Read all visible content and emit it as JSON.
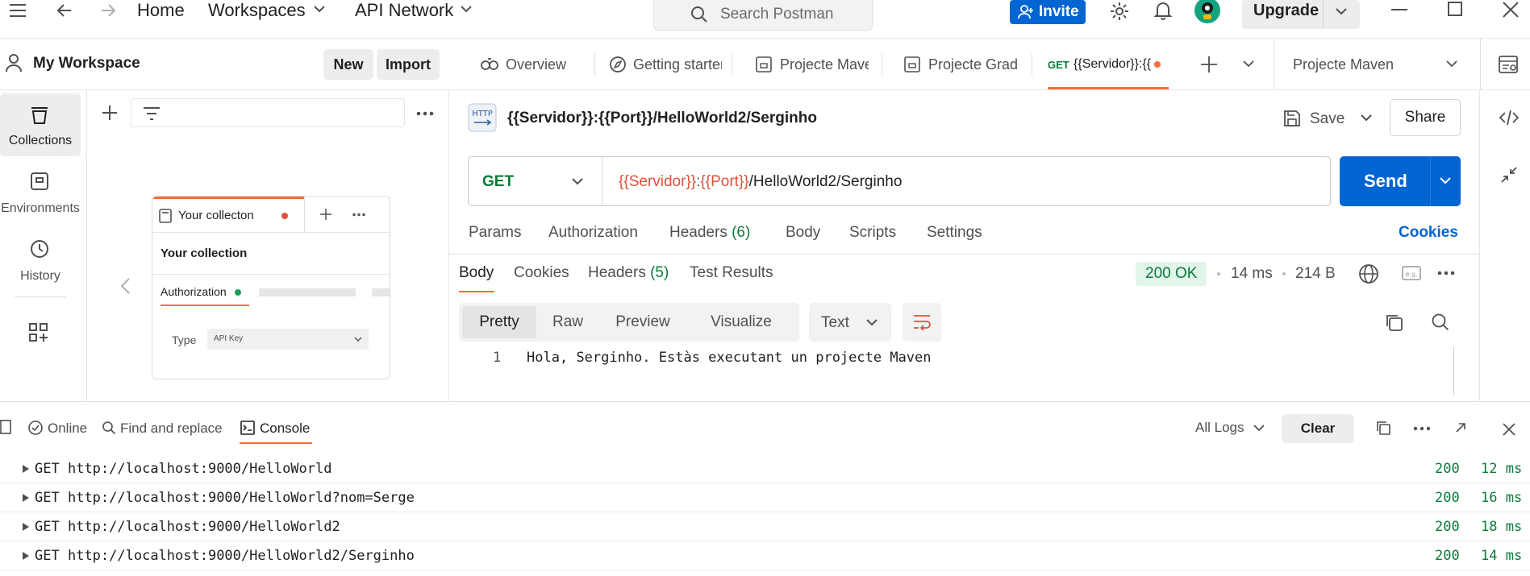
{
  "topbar": {
    "nav_home": "Home",
    "nav_workspaces": "Workspaces",
    "nav_api_network": "API Network",
    "search_placeholder": "Search Postman",
    "invite_label": "Invite",
    "upgrade_label": "Upgrade"
  },
  "workspace": {
    "title": "My Workspace",
    "new_label": "New",
    "import_label": "Import"
  },
  "rail": {
    "items": [
      {
        "label": "Collections",
        "icon": "collections-icon"
      },
      {
        "label": "Environments",
        "icon": "environments-icon"
      },
      {
        "label": "History",
        "icon": "history-icon"
      }
    ]
  },
  "sidepanel": {
    "card_tab_label": "Your collecton",
    "card_title": "Your collection",
    "card_auth_label": "Authorization",
    "card_type_label": "Type",
    "card_type_value": "API Key"
  },
  "tabs": {
    "items": [
      {
        "label": "Overview"
      },
      {
        "label": "Getting starter"
      },
      {
        "label": "Projecte Mave"
      },
      {
        "label": "Projecte Gradl"
      }
    ],
    "active_method": "GET",
    "active_label": "{{Servidor}}:{{",
    "environment": "Projecte Maven"
  },
  "request": {
    "title": "{{Servidor}}:{{Port}}/HelloWorld2/Serginho",
    "save_label": "Save",
    "share_label": "Share",
    "method": "GET",
    "url_var1": "{{Servidor}}",
    "url_colon": ":",
    "url_var2": "{{Port}}",
    "url_path": "/HelloWorld2/Serginho",
    "send_label": "Send",
    "tabs": {
      "params": "Params",
      "authorization": "Authorization",
      "headers": "Headers",
      "headers_count": "(6)",
      "body": "Body",
      "scripts": "Scripts",
      "settings": "Settings",
      "cookies": "Cookies"
    }
  },
  "response": {
    "tabs": {
      "body": "Body",
      "cookies": "Cookies",
      "headers": "Headers",
      "headers_count": "(5)",
      "test_results": "Test Results"
    },
    "status": "200 OK",
    "time": "14 ms",
    "size": "214 B",
    "views": [
      "Pretty",
      "Raw",
      "Preview",
      "Visualize"
    ],
    "format": "Text",
    "line_number": "1",
    "body_text": "Hola, Serginho. Estàs executant un projecte Maven"
  },
  "console": {
    "online_label": "Online",
    "find_label": "Find and replace",
    "console_label": "Console",
    "filter_label": "All Logs",
    "clear_label": "Clear",
    "logs": [
      {
        "method": "GET",
        "url": "http://localhost:9000/HelloWorld",
        "status": "200",
        "time": "12 ms"
      },
      {
        "method": "GET",
        "url": "http://localhost:9000/HelloWorld?nom=Serge",
        "status": "200",
        "time": "16 ms"
      },
      {
        "method": "GET",
        "url": "http://localhost:9000/HelloWorld2",
        "status": "200",
        "time": "18 ms"
      },
      {
        "method": "GET",
        "url": "http://localhost:9000/HelloWorld2/Serginho",
        "status": "200",
        "time": "14 ms"
      }
    ]
  },
  "colors": {
    "accent_orange": "#ff6c37",
    "send_blue": "#0265d2",
    "method_green": "#0a7a3a",
    "variable_orange": "#e0513a",
    "status_green_bg": "#e3f4e9"
  }
}
